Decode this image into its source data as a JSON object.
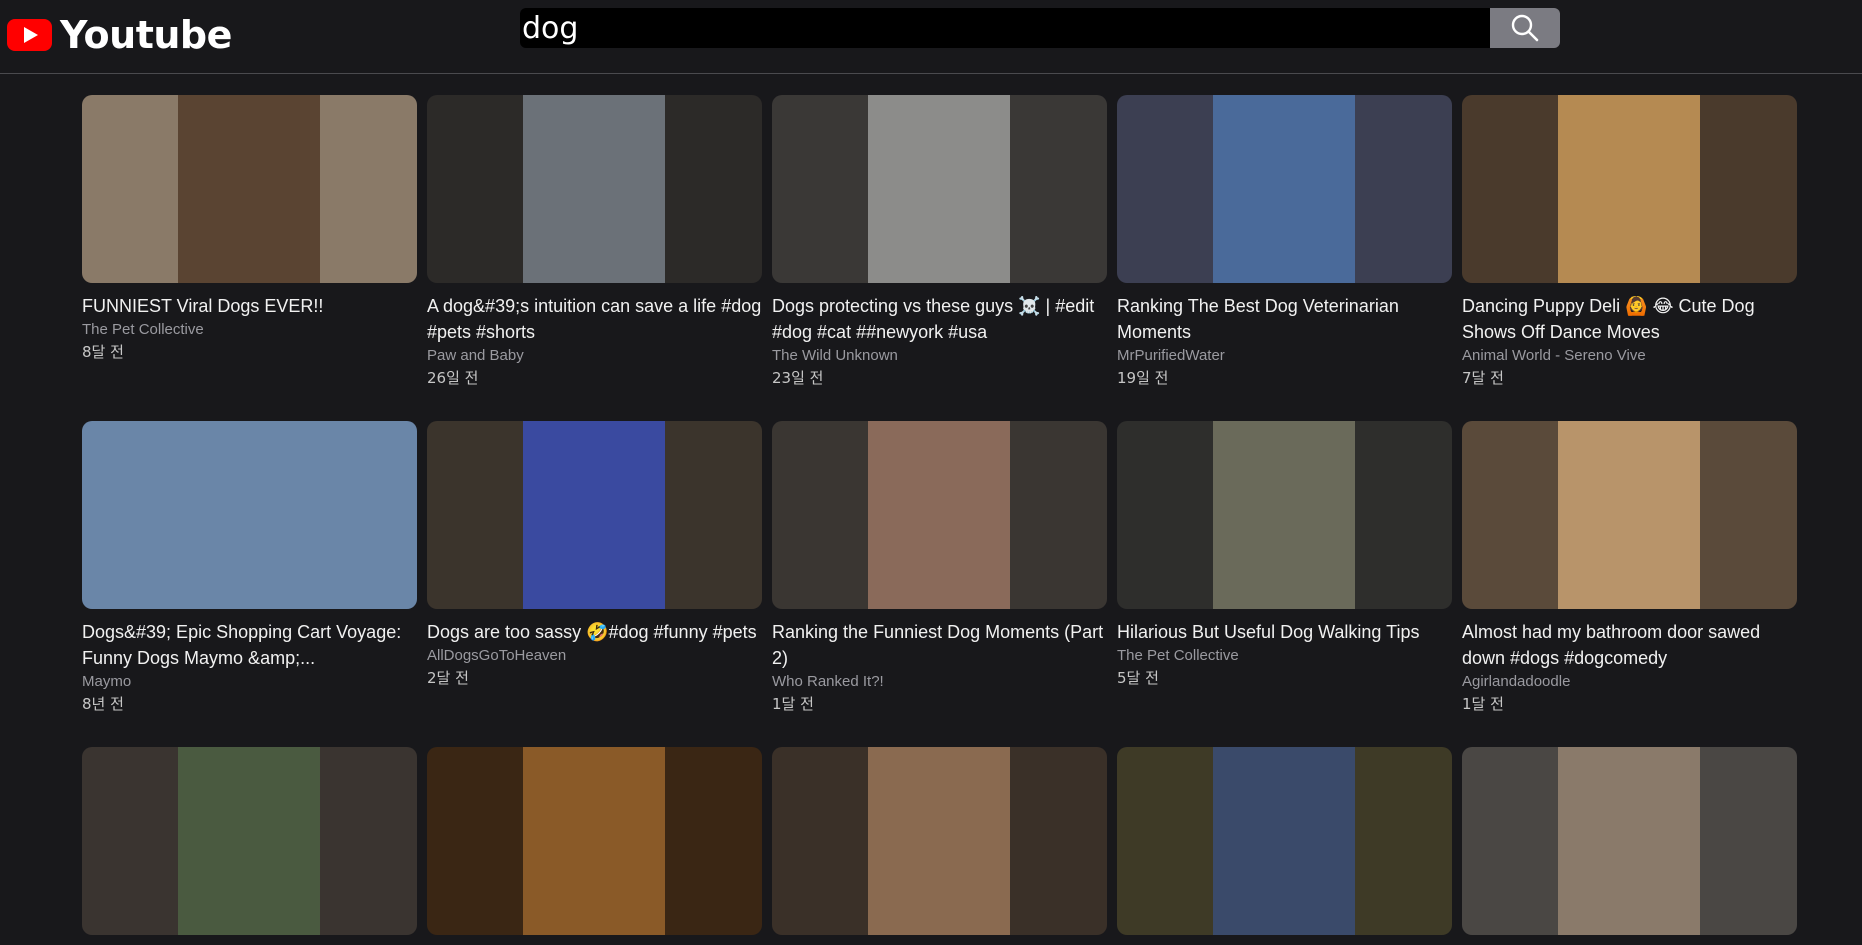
{
  "app": {
    "name": "Youtube",
    "brand_color": "#ff0000"
  },
  "search": {
    "value": "dog",
    "button_icon": "search-icon"
  },
  "videos": [
    {
      "title": "FUNNIEST Viral Dogs EVER!!",
      "channel": "The Pet Collective",
      "age": "8달 전",
      "thumb_bg": "#8a7a68",
      "thumb_inner": "#5a4432"
    },
    {
      "title": "A dog&#39;s intuition can save a life #dog #pets #shorts",
      "channel": "Paw and Baby",
      "age": "26일 전",
      "thumb_bg": "#2c2a28",
      "thumb_inner": "#6b7178"
    },
    {
      "title": "Dogs protecting vs these guys ☠️ | #edit #dog #cat ##newyork #usa",
      "channel": "The Wild Unknown",
      "age": "23일 전",
      "thumb_bg": "#3a3836",
      "thumb_inner": "#8c8c8a"
    },
    {
      "title": "Ranking The Best Dog Veterinarian Moments",
      "channel": "MrPurifiedWater",
      "age": "19일 전",
      "thumb_bg": "#3c3f52",
      "thumb_inner": "#4a6a9a"
    },
    {
      "title": "Dancing Puppy Deli 🙆 😂 Cute Dog Shows Off Dance Moves",
      "channel": "Animal World - Sereno Vive",
      "age": "7달 전",
      "thumb_bg": "#4a3a2c",
      "thumb_inner": "#b58a52"
    },
    {
      "title": "Dogs&#39; Epic Shopping Cart Voyage: Funny Dogs Maymo &amp;...",
      "channel": "Maymo",
      "age": "8년 전",
      "thumb_bg": "#6a86a8",
      "thumb_inner": "#6a86a8"
    },
    {
      "title": "Dogs are too sassy 🤣#dog #funny #pets",
      "channel": "AllDogsGoToHeaven",
      "age": "2달 전",
      "thumb_bg": "#3b342c",
      "thumb_inner": "#3a4aa0"
    },
    {
      "title": "Ranking the Funniest Dog Moments (Part 2)",
      "channel": "Who Ranked It?!",
      "age": "1달 전",
      "thumb_bg": "#3a3632",
      "thumb_inner": "#8a6a5a"
    },
    {
      "title": "Hilarious But Useful Dog Walking Tips",
      "channel": "The Pet Collective",
      "age": "5달 전",
      "thumb_bg": "#2e2e2c",
      "thumb_inner": "#6a6a5a"
    },
    {
      "title": "Almost had my bathroom door sawed down #dogs #dogcomedy",
      "channel": "Agirlandadoodle",
      "age": "1달 전",
      "thumb_bg": "#5a4a3a",
      "thumb_inner": "#b8946a"
    },
    {
      "title": "",
      "channel": "",
      "age": "",
      "thumb_bg": "#3a3430",
      "thumb_inner": "#4a5a40"
    },
    {
      "title": "",
      "channel": "",
      "age": "",
      "thumb_bg": "#3a2614",
      "thumb_inner": "#8a5a28"
    },
    {
      "title": "",
      "channel": "",
      "age": "",
      "thumb_bg": "#3a3028",
      "thumb_inner": "#8a6a50"
    },
    {
      "title": "",
      "channel": "",
      "age": "",
      "thumb_bg": "#3e3a26",
      "thumb_inner": "#3a4a6a"
    },
    {
      "title": "",
      "channel": "",
      "age": "",
      "thumb_bg": "#4a4744",
      "thumb_inner": "#8a7a6a"
    }
  ]
}
